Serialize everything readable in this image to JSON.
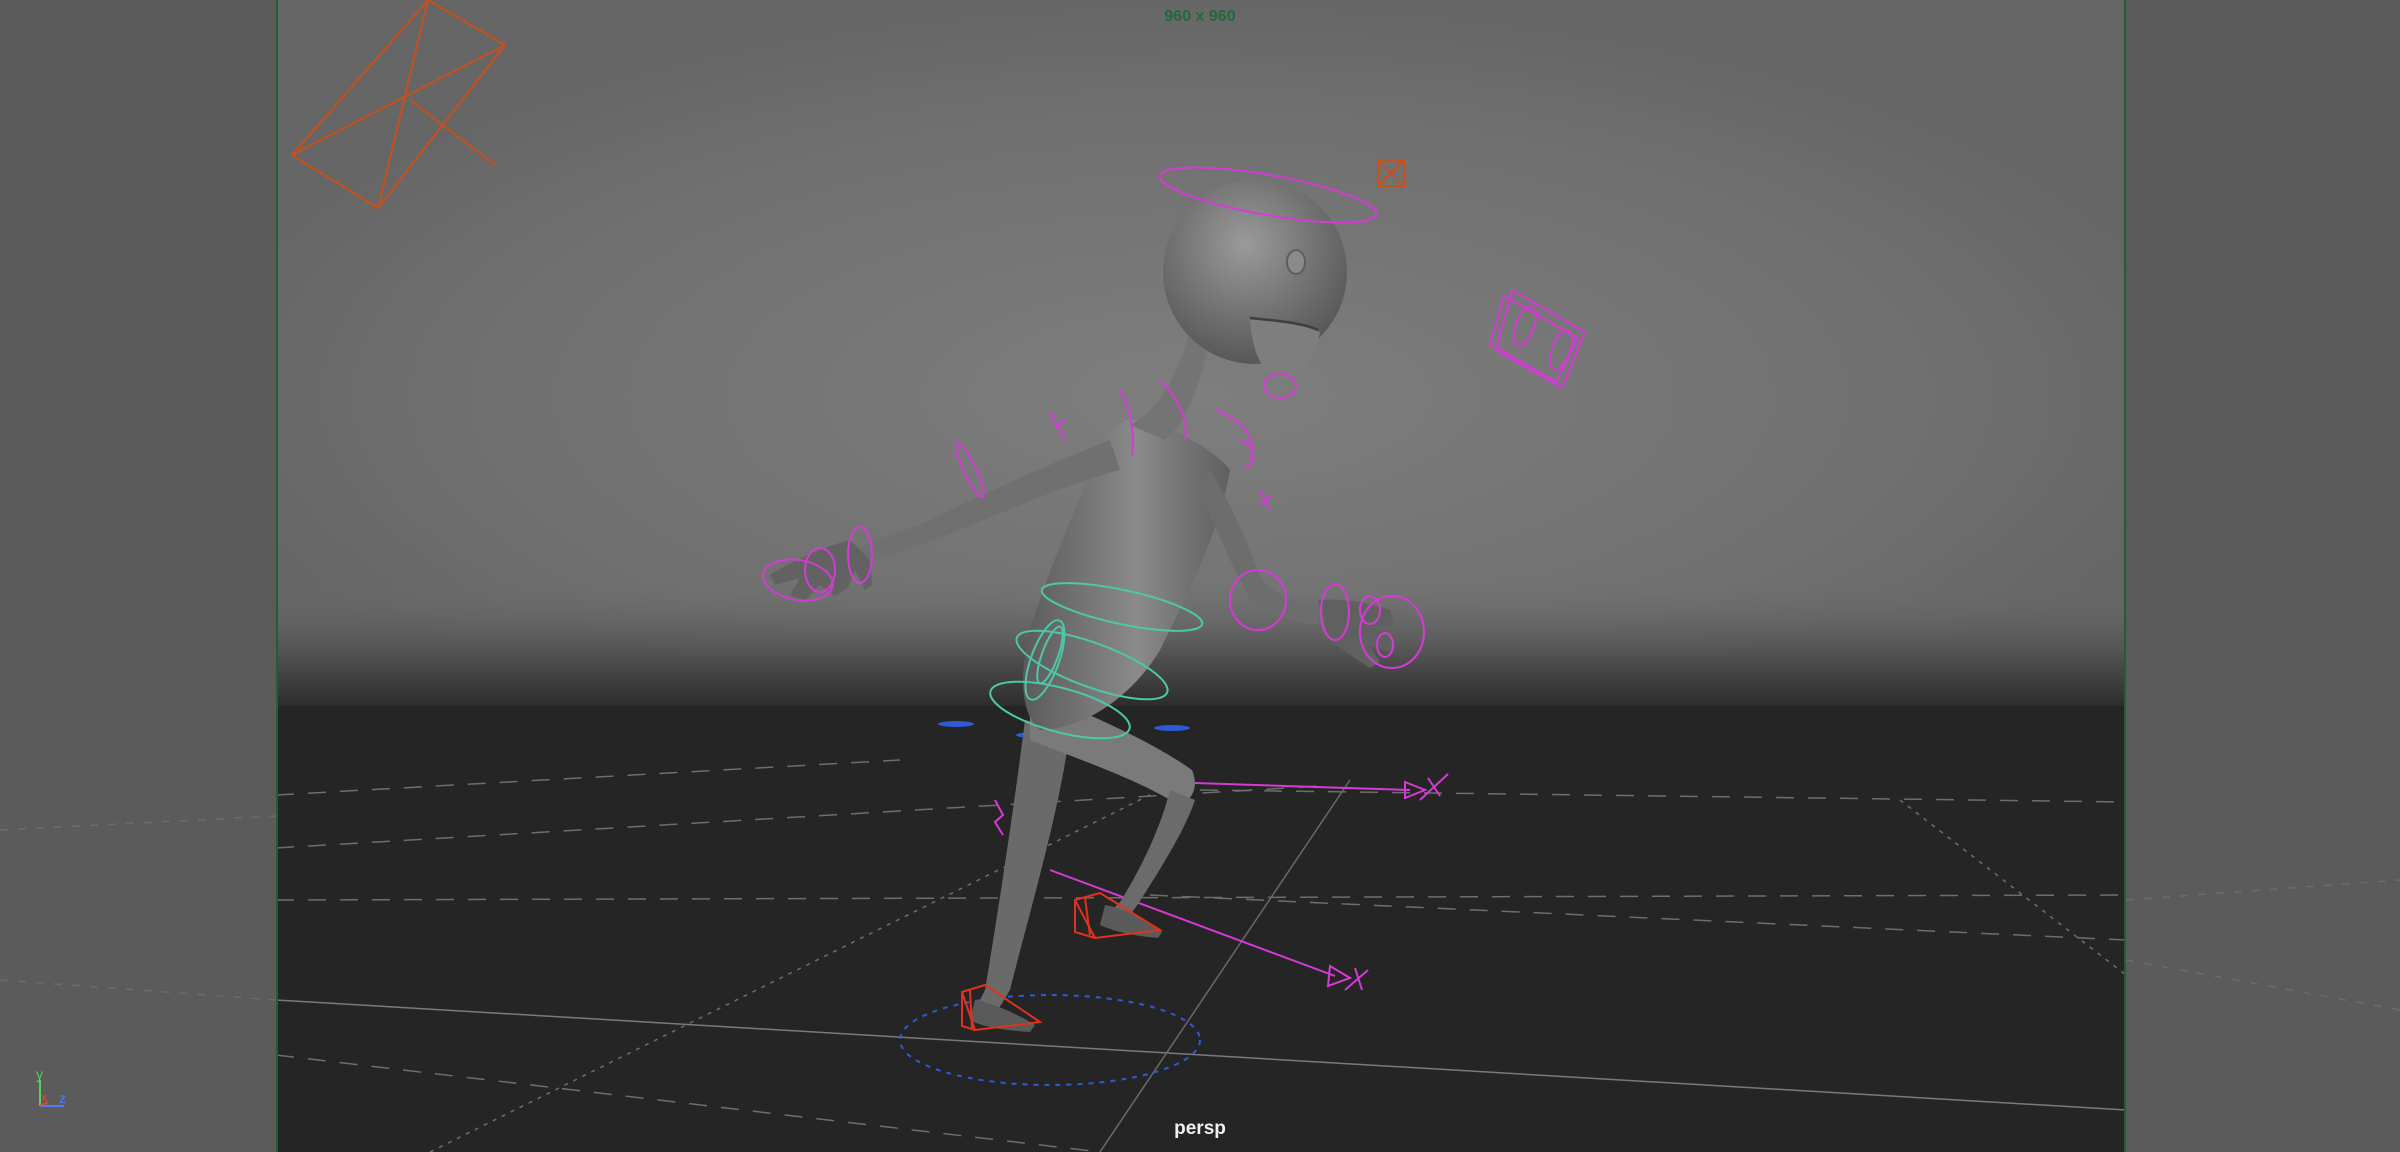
{
  "viewport": {
    "resolution_gate_label": "960 x 960",
    "camera_name": "persp",
    "axis_labels": {
      "y": "y",
      "x": "x",
      "z": "z"
    }
  },
  "colors": {
    "background_outer": "#5a5a5a",
    "sky_top": "#727272",
    "ground": "#252525",
    "gate_border": "#1f5f32",
    "gate_label": "#1f6a35",
    "control_magenta": "#d63ad6",
    "control_teal": "#4ec7a6",
    "ik_red": "#e0321e",
    "camera_orange": "#c8501a",
    "ground_grid": "#6e6e6e"
  },
  "icons": [
    "camera-icon",
    "light-icon",
    "axis-triad-icon"
  ]
}
